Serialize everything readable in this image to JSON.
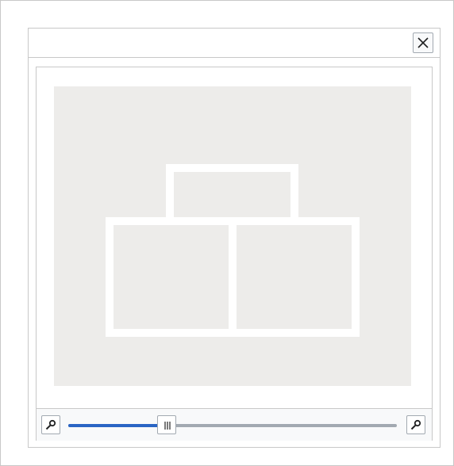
{
  "dialog": {
    "close_icon": "close-icon",
    "preview": {
      "placeholder_icon": "media-placeholder-icon",
      "background_color": "#edecea",
      "stroke_color": "#ffffff"
    },
    "zoom": {
      "zoom_out_icon": "zoom-out-icon",
      "zoom_in_icon": "zoom-in-icon",
      "level": 0.3,
      "fill_color": "#2a65c4",
      "track_color": "#a2a9b1",
      "handle_icon": "grip-icon"
    }
  }
}
